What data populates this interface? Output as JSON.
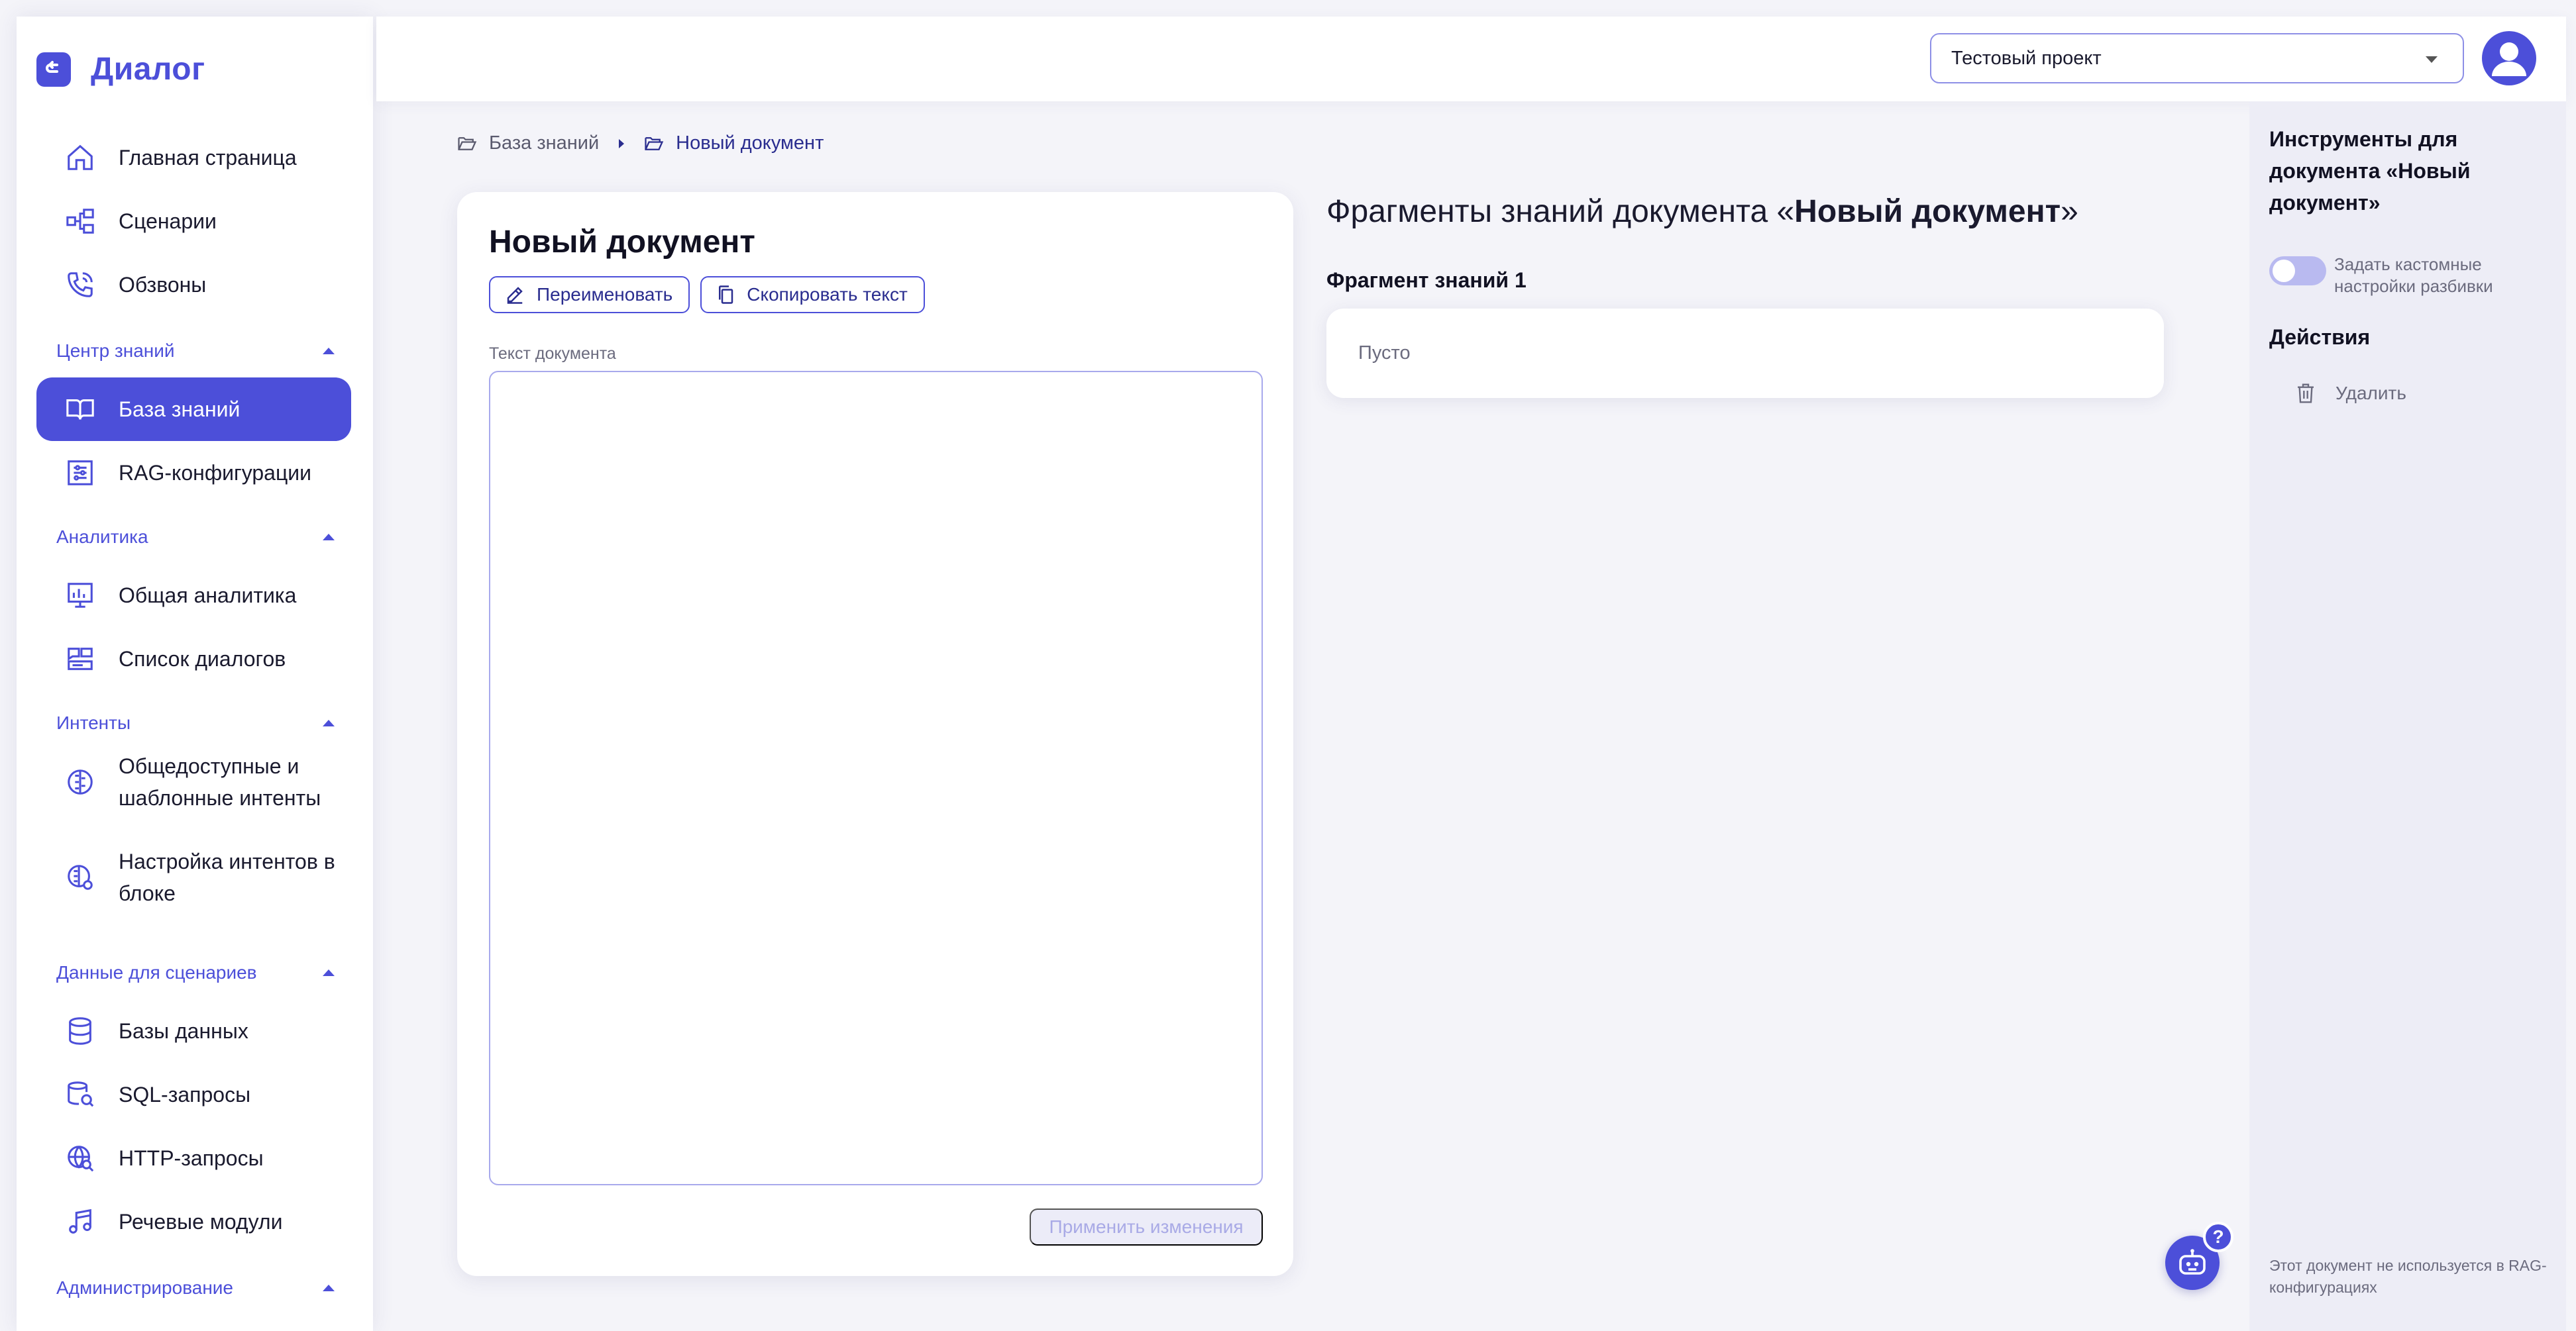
{
  "app": {
    "name": "Диалог"
  },
  "colors": {
    "accent": "#4c4fd9",
    "accent_dark": "#2a2d8f",
    "muted": "#6b6b7e",
    "background": "#f4f4f9"
  },
  "sidebar": {
    "items_top": [
      {
        "label": "Главная страница",
        "icon": "home-icon"
      },
      {
        "label": "Сценарии",
        "icon": "scenarios-icon"
      },
      {
        "label": "Обзвоны",
        "icon": "phone-call-icon"
      }
    ],
    "sections": [
      {
        "title": "Центр знаний",
        "items": [
          {
            "label": "База знаний",
            "icon": "book-icon",
            "active": true
          },
          {
            "label": "RAG-конфигурации",
            "icon": "sliders-icon"
          }
        ]
      },
      {
        "title": "Аналитика",
        "items": [
          {
            "label": "Общая аналитика",
            "icon": "analytics-icon"
          },
          {
            "label": "Список диалогов",
            "icon": "dialogs-icon"
          }
        ]
      },
      {
        "title": "Интенты",
        "items": [
          {
            "label": "Общедоступные и шаблонные интенты",
            "icon": "brain-icon"
          },
          {
            "label": "Настройка интентов в блоке",
            "icon": "brain-gear-icon"
          }
        ]
      },
      {
        "title": "Данные для сценариев",
        "items": [
          {
            "label": "Базы данных",
            "icon": "database-icon"
          },
          {
            "label": "SQL-запросы",
            "icon": "sql-search-icon"
          },
          {
            "label": "HTTP-запросы",
            "icon": "globe-search-icon"
          },
          {
            "label": "Речевые модули",
            "icon": "music-note-icon"
          }
        ]
      },
      {
        "title": "Администрирование",
        "items": []
      }
    ]
  },
  "header": {
    "project_selector": {
      "value": "Тестовый проект"
    }
  },
  "breadcrumb": [
    {
      "label": "База знаний"
    },
    {
      "label": "Новый документ"
    }
  ],
  "editor": {
    "title": "Новый документ",
    "rename_label": "Переименовать",
    "copy_label": "Скопировать текст",
    "text_label": "Текст документа",
    "text_value": "",
    "apply_label": "Применить изменения"
  },
  "fragments": {
    "title_prefix": "Фрагменты знаний документа «",
    "title_doc": "Новый документ",
    "title_suffix": "»",
    "items": [
      {
        "label": "Фрагмент знаний 1",
        "content": "Пусто"
      }
    ]
  },
  "tools": {
    "title": "Инструменты для документа «Новый документ»",
    "toggle_label": "Задать кастомные настройки разбивки",
    "toggle_on": false,
    "actions_title": "Действия",
    "delete_label": "Удалить",
    "note": "Этот документ не используется в RAG-конфигурациях"
  },
  "help": {
    "badge": "?"
  }
}
